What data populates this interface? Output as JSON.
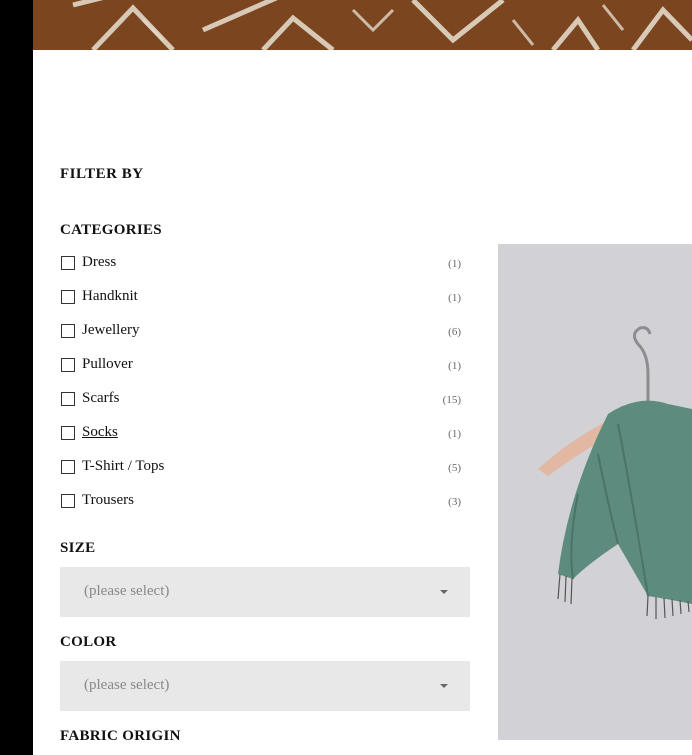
{
  "filter": {
    "title": "FILTER BY"
  },
  "categories": {
    "title": "CATEGORIES",
    "items": [
      {
        "label": "Dress",
        "count": "(1)"
      },
      {
        "label": "Handknit",
        "count": "(1)"
      },
      {
        "label": "Jewellery",
        "count": "(6)"
      },
      {
        "label": "Pullover",
        "count": "(1)"
      },
      {
        "label": "Scarfs",
        "count": "(15)"
      },
      {
        "label": "Socks",
        "count": "(1)"
      },
      {
        "label": "T-Shirt / Tops",
        "count": "(5)"
      },
      {
        "label": "Trousers",
        "count": "(3)"
      }
    ]
  },
  "size": {
    "title": "SIZE",
    "placeholder": "(please select)"
  },
  "color": {
    "title": "COLOR",
    "placeholder": "(please select)"
  },
  "fabric_origin": {
    "title": "FABRIC ORIGIN"
  },
  "colors": {
    "banner": "#7a451f",
    "select_bg": "#e8e8e8",
    "product_bg": "#d2d1d6",
    "scarf": "#5d8c7f"
  }
}
